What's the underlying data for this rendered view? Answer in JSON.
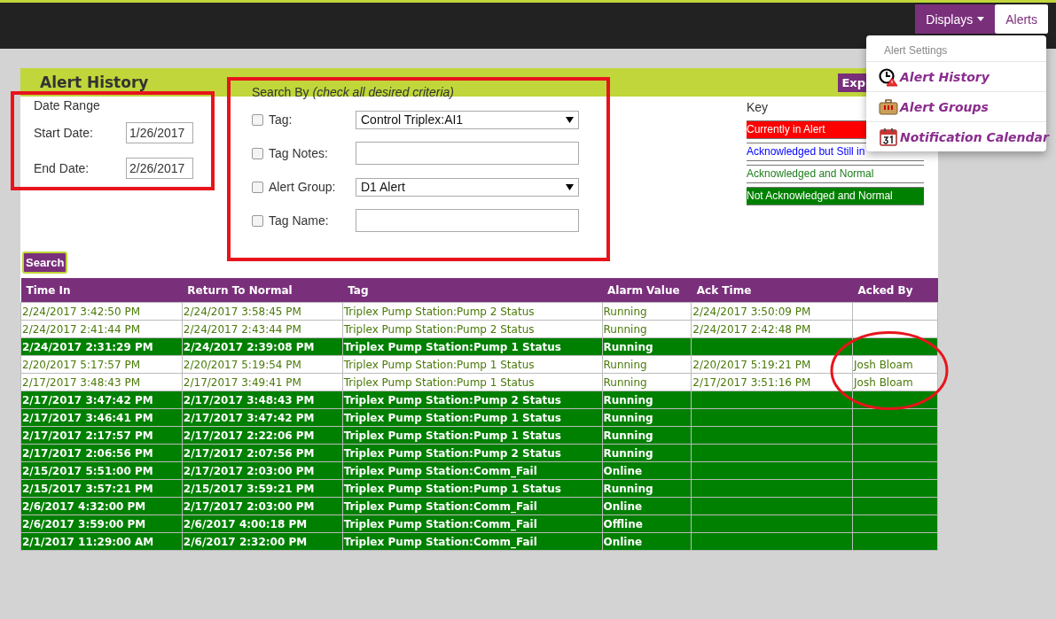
{
  "nav": {
    "buttons": [
      {
        "label": "Displays",
        "kind": "dropdown",
        "selected": true
      },
      {
        "label": "Alerts",
        "kind": "plain",
        "selected": false
      }
    ]
  },
  "menu": {
    "header": "Alert Settings",
    "items": [
      {
        "label": "Alert History",
        "kind": "history"
      },
      {
        "label": "Alert Groups",
        "kind": "groups"
      },
      {
        "label": "Notification Calendar",
        "kind": "calendar"
      }
    ]
  },
  "panel": {
    "title": "Alert History",
    "export_button": "Exp"
  },
  "date_range": {
    "title": "Date Range",
    "fields": [
      {
        "label": "Start Date:",
        "value": "1/26/2017"
      },
      {
        "label": "End Date:",
        "value": "2/26/2017"
      }
    ]
  },
  "search_by": {
    "title": "Search By",
    "hint": "(check all desired criteria)",
    "criteria": [
      {
        "label": "Tag:",
        "kind": "select",
        "value": "Control Triplex:AI1",
        "checked": false
      },
      {
        "label": "Tag Notes:",
        "kind": "text",
        "checked": false
      },
      {
        "label": "Alert Group:",
        "kind": "select",
        "value": "D1 Alert",
        "checked": false
      },
      {
        "label": "Tag Name:",
        "kind": "text",
        "checked": false
      }
    ]
  },
  "key": {
    "title": "Key",
    "items": [
      {
        "label": "Currently in Alert",
        "kind": "in_alert"
      },
      {
        "label": "Acknowledged but Still in",
        "kind": "acked_in_alert"
      },
      {
        "label": "Acknowledged and Normal",
        "kind": "acked_normal"
      },
      {
        "label": "Not Acknowledged and Normal",
        "kind": "not_acked_normal"
      }
    ]
  },
  "search_button": "Search",
  "table": {
    "columns": [
      "Time In",
      "Return To Normal",
      "Tag",
      "Alarm Value",
      "Ack Time",
      "Acked By"
    ],
    "rows": [
      {
        "kind": "acked_normal",
        "cells": [
          "2/24/2017 3:42:50 PM",
          "2/24/2017 3:58:45 PM",
          "Triplex Pump Station:Pump 2 Status",
          "Running",
          "2/24/2017 3:50:09 PM",
          ""
        ]
      },
      {
        "kind": "acked_normal",
        "cells": [
          "2/24/2017 2:41:44 PM",
          "2/24/2017 2:43:44 PM",
          "Triplex Pump Station:Pump 2 Status",
          "Running",
          "2/24/2017 2:42:48 PM",
          ""
        ]
      },
      {
        "kind": "not_acked_normal",
        "cells": [
          "2/24/2017 2:31:29 PM",
          "2/24/2017 2:39:08 PM",
          "Triplex Pump Station:Pump 1 Status",
          "Running",
          "",
          ""
        ]
      },
      {
        "kind": "acked_normal",
        "cells": [
          "2/20/2017 5:17:57 PM",
          "2/20/2017 5:19:54 PM",
          "Triplex Pump Station:Pump 1 Status",
          "Running",
          "2/20/2017 5:19:21 PM",
          "Josh Bloam"
        ]
      },
      {
        "kind": "acked_normal",
        "cells": [
          "2/17/2017 3:48:43 PM",
          "2/17/2017 3:49:41 PM",
          "Triplex Pump Station:Pump 1 Status",
          "Running",
          "2/17/2017 3:51:16 PM",
          "Josh Bloam"
        ]
      },
      {
        "kind": "not_acked_normal",
        "cells": [
          "2/17/2017 3:47:42 PM",
          "2/17/2017 3:48:43 PM",
          "Triplex Pump Station:Pump 2 Status",
          "Running",
          "",
          ""
        ]
      },
      {
        "kind": "not_acked_normal",
        "cells": [
          "2/17/2017 3:46:41 PM",
          "2/17/2017 3:47:42 PM",
          "Triplex Pump Station:Pump 1 Status",
          "Running",
          "",
          ""
        ]
      },
      {
        "kind": "not_acked_normal",
        "cells": [
          "2/17/2017 2:17:57 PM",
          "2/17/2017 2:22:06 PM",
          "Triplex Pump Station:Pump 1 Status",
          "Running",
          "",
          ""
        ]
      },
      {
        "kind": "not_acked_normal",
        "cells": [
          "2/17/2017 2:06:56 PM",
          "2/17/2017 2:07:56 PM",
          "Triplex Pump Station:Pump 2 Status",
          "Running",
          "",
          ""
        ]
      },
      {
        "kind": "not_acked_normal",
        "cells": [
          "2/15/2017 5:51:00 PM",
          "2/17/2017 2:03:00 PM",
          "Triplex Pump Station:Comm_Fail",
          "Online",
          "",
          ""
        ]
      },
      {
        "kind": "not_acked_normal",
        "cells": [
          "2/15/2017 3:57:21 PM",
          "2/15/2017 3:59:21 PM",
          "Triplex Pump Station:Pump 1 Status",
          "Running",
          "",
          ""
        ]
      },
      {
        "kind": "not_acked_normal",
        "cells": [
          "2/6/2017 4:32:00 PM",
          "2/17/2017 2:03:00 PM",
          "Triplex Pump Station:Comm_Fail",
          "Online",
          "",
          ""
        ]
      },
      {
        "kind": "not_acked_normal",
        "cells": [
          "2/6/2017 3:59:00 PM",
          "2/6/2017 4:00:18 PM",
          "Triplex Pump Station:Comm_Fail",
          "Offline",
          "",
          ""
        ]
      },
      {
        "kind": "not_acked_normal",
        "cells": [
          "2/1/2017 11:29:00 AM",
          "2/6/2017 2:32:00 PM",
          "Triplex Pump Station:Comm_Fail",
          "Online",
          "",
          ""
        ]
      }
    ]
  }
}
